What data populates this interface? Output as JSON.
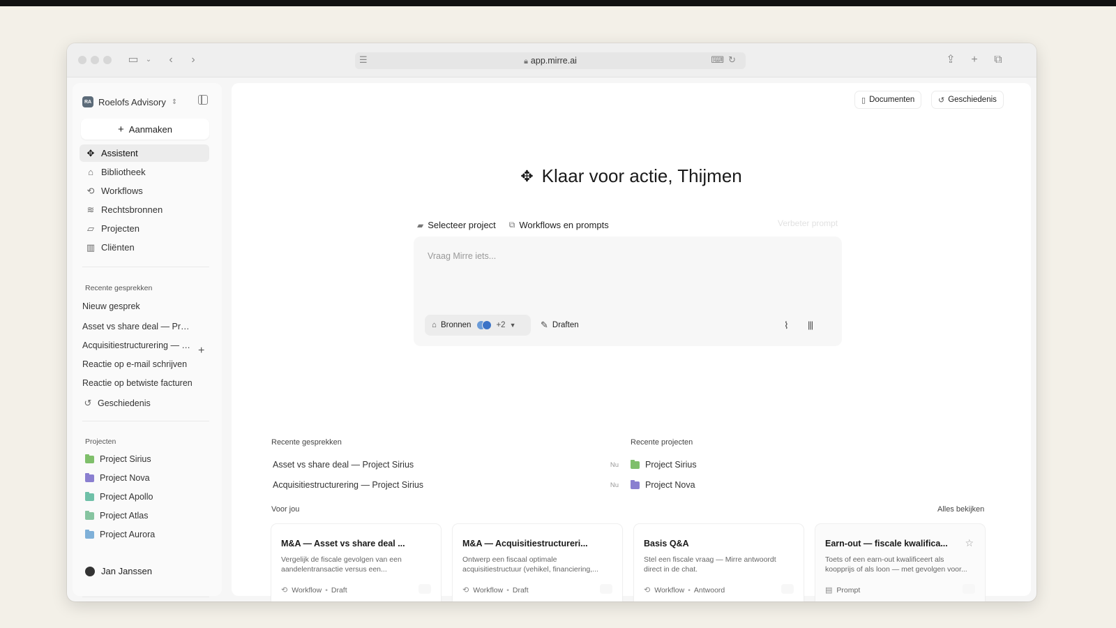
{
  "browser": {
    "url": "app.mirre.ai"
  },
  "sidebar": {
    "workspace": {
      "name": "Roelofs Advisory",
      "badge": "RA"
    },
    "create_label": "Aanmaken",
    "nav": [
      {
        "label": "Assistent",
        "icon": "assistant-icon"
      },
      {
        "label": "Bibliotheek",
        "icon": "library-icon"
      },
      {
        "label": "Workflows",
        "icon": "workflow-icon"
      },
      {
        "label": "Rechtsbronnen",
        "icon": "layers-icon"
      },
      {
        "label": "Projecten",
        "icon": "folder-icon"
      },
      {
        "label": "Cliënten",
        "icon": "building-icon"
      }
    ],
    "recent_heading": "Recente gesprekken",
    "new_chat": "Nieuw gesprek",
    "recent": [
      "Asset vs share deal — Project Sirius",
      "Acquisitiestructurering — Project Sirius",
      "Reactie op e-mail schrijven",
      "Reactie op betwiste facturen"
    ],
    "history": "Geschiedenis",
    "projects_heading": "Projecten",
    "projects": [
      {
        "name": "Project Sirius",
        "color": "#7fbf6b"
      },
      {
        "name": "Project Nova",
        "color": "#8a7fd0"
      },
      {
        "name": "Project Apollo",
        "color": "#6fc0a8"
      },
      {
        "name": "Project Atlas",
        "color": "#86c4a0"
      },
      {
        "name": "Project Aurora",
        "color": "#7fb0d8"
      }
    ],
    "user": "Jan Janssen"
  },
  "header": {
    "documents": "Documenten",
    "history": "Geschiedenis"
  },
  "main": {
    "greeting": "Klaar voor actie, Thijmen",
    "select_project": "Selecteer project",
    "workflows_prompts": "Workflows en prompts",
    "improve_prompt": "Verbeter prompt",
    "input_placeholder": "Vraag Mirre iets...",
    "sources_label": "Bronnen",
    "sources_more": "+2",
    "drafts_label": "Draften"
  },
  "recent_conversations": {
    "heading": "Recente gesprekken",
    "items": [
      {
        "title": "Asset vs share deal — Project Sirius",
        "time": "Nu"
      },
      {
        "title": "Acquisitiestructurering — Project Sirius",
        "time": "Nu"
      }
    ]
  },
  "recent_projects": {
    "heading": "Recente projecten",
    "items": [
      {
        "name": "Project Sirius",
        "color": "#7fbf6b"
      },
      {
        "name": "Project Nova",
        "color": "#8a7fd0"
      }
    ]
  },
  "for_you": {
    "heading": "Voor jou",
    "see_all": "Alles bekijken",
    "cards": [
      {
        "title": "M&A — Asset vs share deal ...",
        "description": "Vergelijk de fiscale gevolgen van een aandelentransactie versus een...",
        "type": "Workflow",
        "tag": "Draft"
      },
      {
        "title": "M&A — Acquisitiestructureri...",
        "description": "Ontwerp een fiscaal optimale acquisitiestructuur (vehikel, financiering,...",
        "type": "Workflow",
        "tag": "Draft"
      },
      {
        "title": "Basis Q&A",
        "description": "Stel een fiscale vraag — Mirre antwoordt direct in de chat.",
        "type": "Workflow",
        "tag": "Antwoord"
      },
      {
        "title": "Earn-out — fiscale kwalifica...",
        "description": "Toets of een earn-out kwalificeert als koopprijs of als loon — met gevolgen voor...",
        "type": "Prompt",
        "tag": ""
      }
    ]
  }
}
